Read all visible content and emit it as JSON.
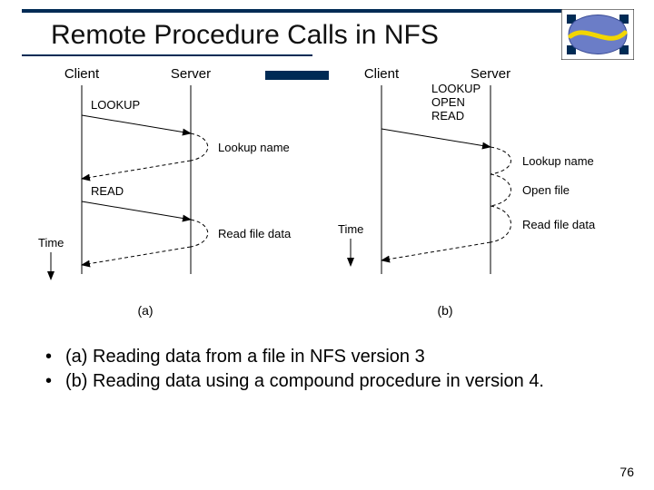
{
  "title": "Remote Procedure Calls in NFS",
  "page_number": "76",
  "bullets": {
    "a": "(a) Reading data from a file in NFS version 3",
    "b": "(b) Reading data using a compound procedure in version 4."
  },
  "diagram": {
    "a": {
      "client": "Client",
      "server": "Server",
      "req1": "LOOKUP",
      "reply1": "Lookup name",
      "req2": "READ",
      "reply2": "Read file data",
      "time": "Time",
      "caption": "(a)"
    },
    "b": {
      "client": "Client",
      "server": "Server",
      "req_lines": {
        "l1": "LOOKUP",
        "l2": "OPEN",
        "l3": "READ"
      },
      "reply1": "Lookup name",
      "reply2": "Open file",
      "reply3": "Read file data",
      "time": "Time",
      "caption": "(b)"
    }
  }
}
